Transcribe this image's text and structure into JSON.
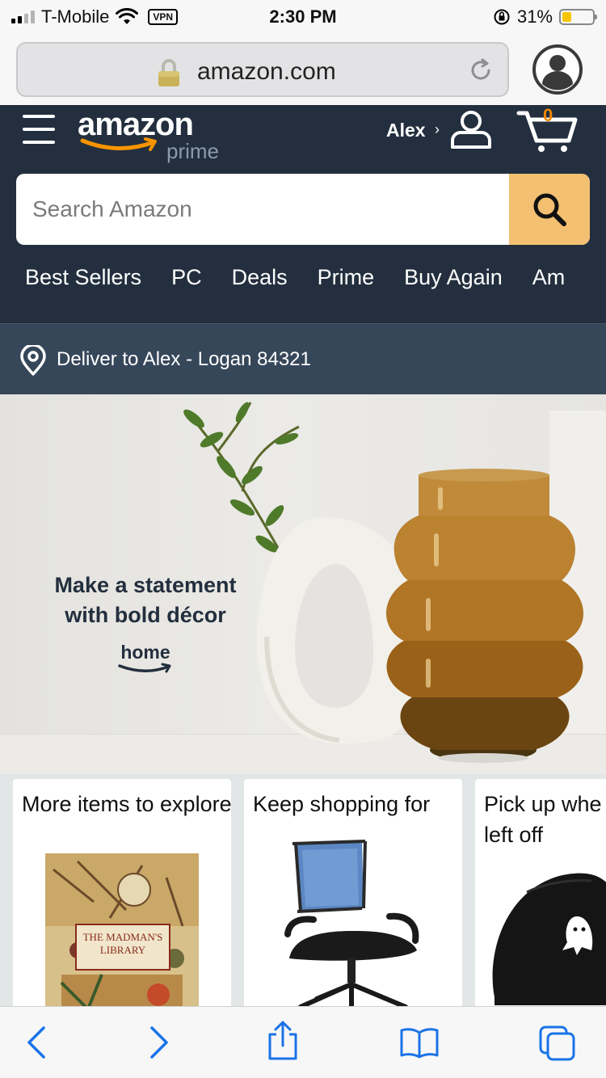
{
  "status_bar": {
    "carrier": "T-Mobile",
    "vpn": "VPN",
    "time": "2:30 PM",
    "battery": "31%",
    "battery_level": 0.31
  },
  "browser": {
    "url": "amazon.com"
  },
  "header": {
    "logo_word": "amazon",
    "logo_sub": "prime",
    "user_name": "Alex",
    "user_chevron": "›",
    "cart_count": "0",
    "search_placeholder": "Search Amazon",
    "nav_links": [
      "Best Sellers",
      "PC",
      "Deals",
      "Prime",
      "Buy Again",
      "Am"
    ]
  },
  "deliver": {
    "text": "Deliver to Alex - Logan 84321"
  },
  "hero": {
    "headline_line1": "Make a statement",
    "headline_line2": "with bold décor",
    "brand": "home"
  },
  "cards": [
    {
      "title": "More items to explore",
      "image": "book-cover",
      "book_title": "THE MADMAN'S LIBRARY"
    },
    {
      "title": "Keep shopping for",
      "image": "office-chair"
    },
    {
      "title": "Pick up where you left off",
      "title_visible": "Pick up whe",
      "title_line2": "left off",
      "image": "black-cap"
    }
  ],
  "colors": {
    "header_bg": "#232f3e",
    "deliver_bg": "#37475a",
    "search_button": "#f3c072",
    "cart_badge": "#f08804",
    "toolbar_icons": "#1a73e8"
  }
}
